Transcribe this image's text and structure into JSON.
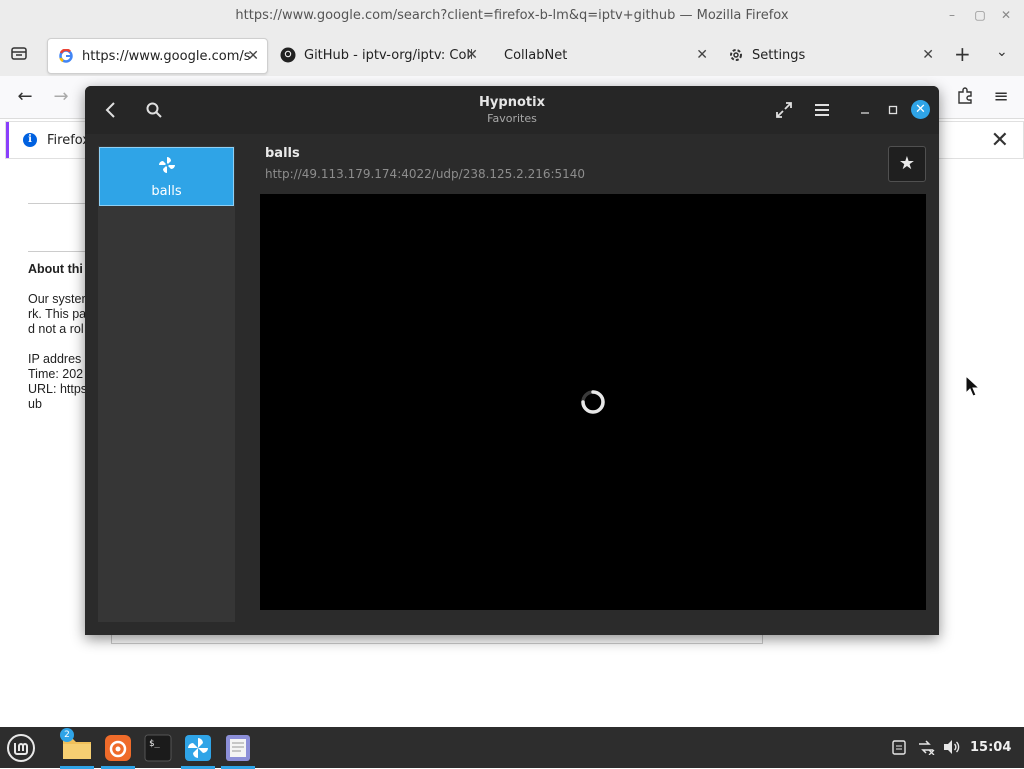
{
  "firefox": {
    "window_title": "https://www.google.com/search?client=firefox-b-lm&q=iptv+github — Mozilla Firefox",
    "tabs": [
      {
        "label": "https://www.google.com/se",
        "icon": "google-icon",
        "active": true
      },
      {
        "label": "GitHub - iptv-org/iptv: Colle",
        "icon": "github-icon",
        "active": false
      },
      {
        "label": "CollabNet",
        "icon": "",
        "active": false
      },
      {
        "label": "Settings",
        "icon": "gear-icon",
        "active": false
      }
    ],
    "notification": {
      "text": "Firefox"
    },
    "page": {
      "heading": "About thi",
      "lines": [
        "Our syster",
        "rk. This pa",
        "d not a rol",
        "IP addres",
        "Time: 202",
        "URL: https",
        "ub"
      ]
    }
  },
  "hypnotix": {
    "title": "Hypnotix",
    "subtitle": "Favorites",
    "sidebar": {
      "items": [
        {
          "label": "balls",
          "icon": "pinwheel-icon"
        }
      ]
    },
    "channel": {
      "name": "balls",
      "url": "http://49.113.179.174:4022/udp/238.125.2.216:5140"
    },
    "favorite_glyph": "★",
    "accent_color": "#2fa4e7"
  },
  "taskbar": {
    "apps": [
      {
        "name": "mint-menu",
        "icon": "linux-mint-icon"
      },
      {
        "name": "files",
        "icon": "folder-icon",
        "badge": "2"
      },
      {
        "name": "firefox",
        "icon": "firefox-icon"
      },
      {
        "name": "terminal",
        "icon": "terminal-icon"
      },
      {
        "name": "hypnotix",
        "icon": "hypnotix-icon"
      },
      {
        "name": "text-editor",
        "icon": "text-editor-icon"
      }
    ],
    "clock": "15:04"
  }
}
